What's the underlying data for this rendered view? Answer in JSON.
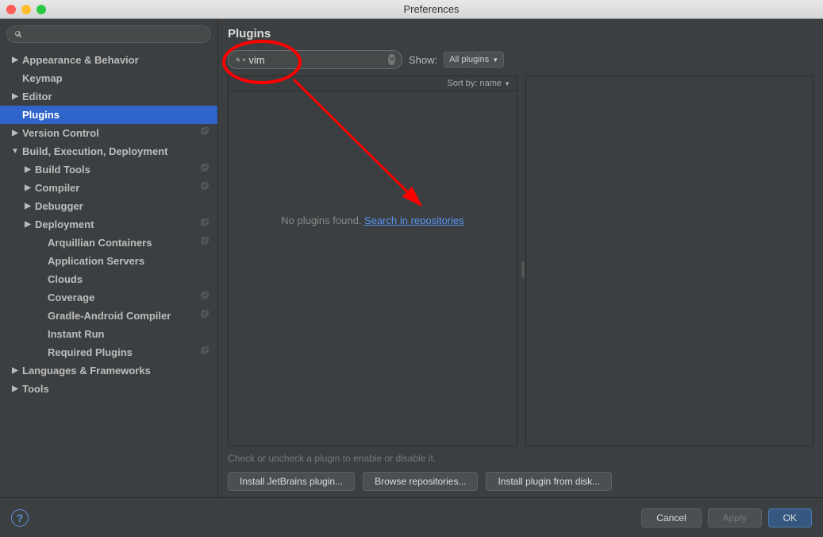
{
  "window": {
    "title": "Preferences"
  },
  "sidebar": {
    "items": [
      {
        "label": "Appearance & Behavior",
        "depth": 0,
        "chev": "▶",
        "copy": false
      },
      {
        "label": "Keymap",
        "depth": 0,
        "chev": "",
        "copy": false
      },
      {
        "label": "Editor",
        "depth": 0,
        "chev": "▶",
        "copy": false
      },
      {
        "label": "Plugins",
        "depth": 0,
        "chev": "",
        "copy": false,
        "selected": true
      },
      {
        "label": "Version Control",
        "depth": 0,
        "chev": "▶",
        "copy": true
      },
      {
        "label": "Build, Execution, Deployment",
        "depth": 0,
        "chev": "▼",
        "copy": false
      },
      {
        "label": "Build Tools",
        "depth": 1,
        "chev": "▶",
        "copy": true
      },
      {
        "label": "Compiler",
        "depth": 1,
        "chev": "▶",
        "copy": true
      },
      {
        "label": "Debugger",
        "depth": 1,
        "chev": "▶",
        "copy": false
      },
      {
        "label": "Deployment",
        "depth": 1,
        "chev": "▶",
        "copy": true
      },
      {
        "label": "Arquillian Containers",
        "depth": 2,
        "chev": "",
        "copy": true
      },
      {
        "label": "Application Servers",
        "depth": 2,
        "chev": "",
        "copy": false
      },
      {
        "label": "Clouds",
        "depth": 2,
        "chev": "",
        "copy": false
      },
      {
        "label": "Coverage",
        "depth": 2,
        "chev": "",
        "copy": true
      },
      {
        "label": "Gradle-Android Compiler",
        "depth": 2,
        "chev": "",
        "copy": true
      },
      {
        "label": "Instant Run",
        "depth": 2,
        "chev": "",
        "copy": false
      },
      {
        "label": "Required Plugins",
        "depth": 2,
        "chev": "",
        "copy": true
      },
      {
        "label": "Languages & Frameworks",
        "depth": 0,
        "chev": "▶",
        "copy": false
      },
      {
        "label": "Tools",
        "depth": 0,
        "chev": "▶",
        "copy": false
      }
    ]
  },
  "main": {
    "heading": "Plugins",
    "search_value": "vim",
    "show_label": "Show:",
    "show_combo": "All plugins",
    "sort_label": "Sort by: name",
    "no_results_text": "No plugins found. ",
    "search_repos_link": "Search in repositories",
    "hint": "Check or uncheck a plugin to enable or disable it.",
    "buttons": {
      "install_jb": "Install JetBrains plugin...",
      "browse": "Browse repositories...",
      "install_disk": "Install plugin from disk..."
    }
  },
  "footer": {
    "cancel": "Cancel",
    "apply": "Apply",
    "ok": "OK"
  }
}
